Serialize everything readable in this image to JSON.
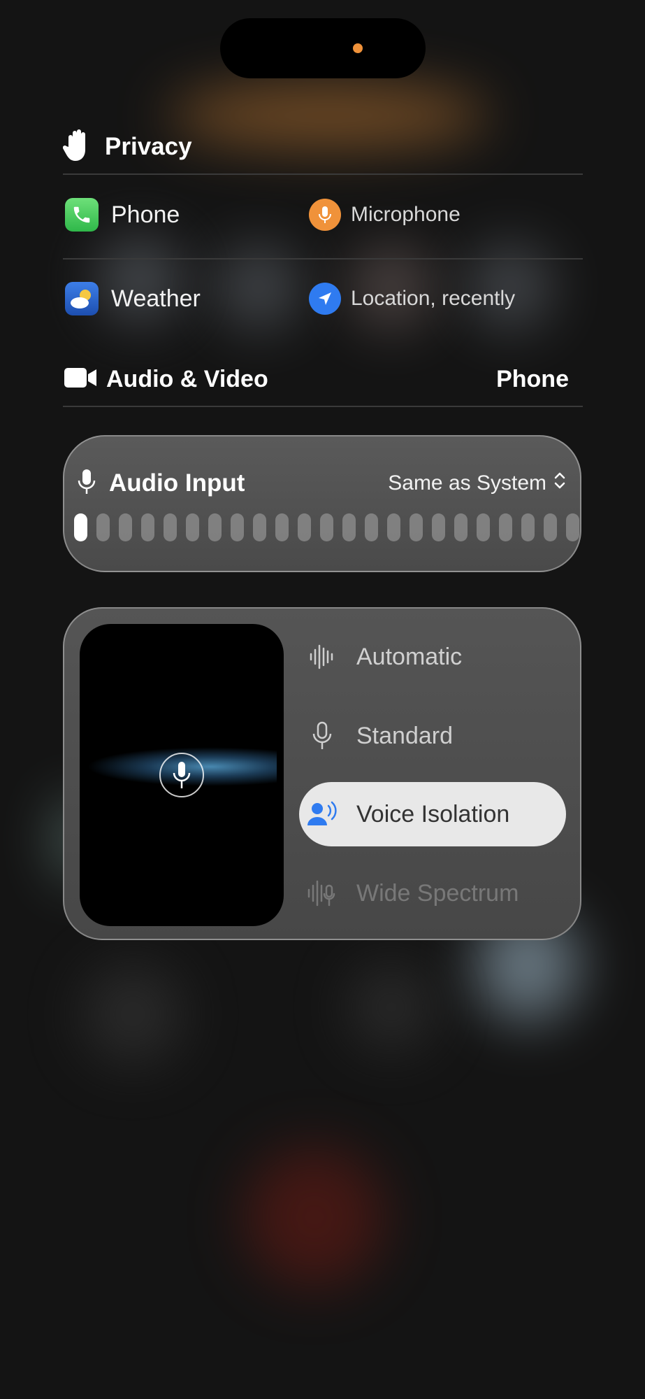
{
  "privacy": {
    "title": "Privacy"
  },
  "apps": [
    {
      "name": "Phone",
      "permission": "Microphone"
    },
    {
      "name": "Weather",
      "permission": "Location, recently"
    }
  ],
  "audio_video": {
    "title": "Audio & Video",
    "app": "Phone"
  },
  "audio_input": {
    "title": "Audio Input",
    "source": "Same as System",
    "level_bars_total": 23,
    "level_bars_active": 1
  },
  "mic_modes": {
    "items": [
      "Automatic",
      "Standard",
      "Voice Isolation",
      "Wide Spectrum"
    ],
    "selected": "Voice Isolation"
  },
  "colors": {
    "indicator": "#f0923a",
    "location": "#2f7bf0",
    "voice_isolation_icon": "#2f7bf0"
  }
}
